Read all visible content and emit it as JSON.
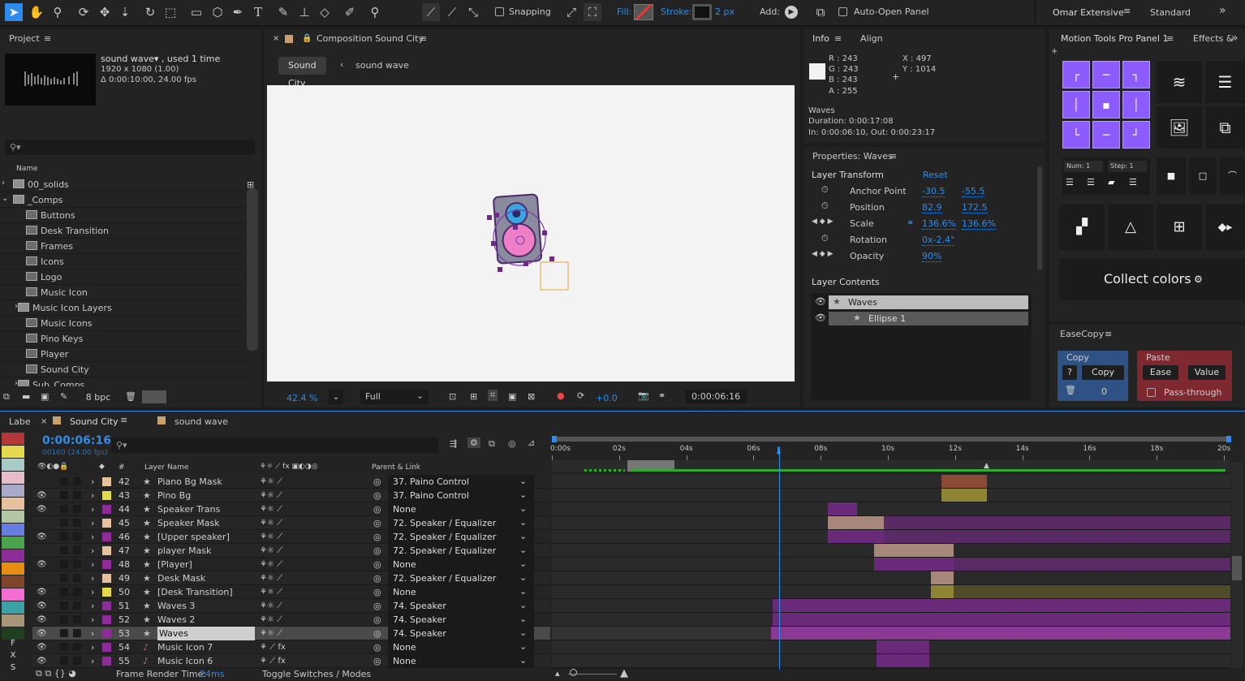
{
  "toolbar": {
    "snapping_label": "Snapping",
    "fill_label": "Fill:",
    "stroke_label": "Stroke:",
    "stroke_value": "2 px",
    "add_label": "Add:",
    "auto_open_label": "Auto-Open Panel",
    "workspace_active": "Omar Extensive",
    "workspace_other": "Standard"
  },
  "project": {
    "title": "Project",
    "item_name": "sound wave▾ , used 1 time",
    "item_res": "1920 x 1080 (1.00)",
    "item_dur": "Δ 0:00:10:00, 24.00 fps",
    "name_header": "Name",
    "bpc": "8 bpc",
    "items": [
      {
        "label": "00_solids",
        "type": "folder",
        "indent": 0
      },
      {
        "label": "_Comps",
        "type": "folder-open",
        "indent": 0
      },
      {
        "label": "Buttons",
        "type": "comp",
        "indent": 1
      },
      {
        "label": "Desk Transition",
        "type": "comp",
        "indent": 1
      },
      {
        "label": "Frames",
        "type": "comp",
        "indent": 1
      },
      {
        "label": "Icons",
        "type": "comp",
        "indent": 1
      },
      {
        "label": "Logo",
        "type": "comp",
        "indent": 1
      },
      {
        "label": "Music Icon",
        "type": "comp",
        "indent": 1
      },
      {
        "label": "Music Icon Layers",
        "type": "folder",
        "indent": 1
      },
      {
        "label": "Music Icons",
        "type": "comp",
        "indent": 1
      },
      {
        "label": "Pino Keys",
        "type": "comp",
        "indent": 1
      },
      {
        "label": "Player",
        "type": "comp",
        "indent": 1
      },
      {
        "label": "Sound City",
        "type": "comp",
        "indent": 1
      },
      {
        "label": "Sub_Comps",
        "type": "folder",
        "indent": 1
      }
    ]
  },
  "composition": {
    "title": "Composition Sound City",
    "crumb_active": "Sound City",
    "crumb_next": "sound wave",
    "zoom": "42.4 %",
    "quality": "Full",
    "exposure": "+0.0",
    "timecode": "0:00:06:16"
  },
  "info": {
    "tab_info": "Info",
    "tab_align": "Align",
    "r": "R : 243",
    "g": "G : 243",
    "b": "B : 243",
    "a": "A : 255",
    "x": "X : 497",
    "y": "Y : 1014",
    "layer": "Waves",
    "duration": "Duration: 0:00:17:08",
    "inout": "In: 0:00:06:10, Out: 0:00:23:17"
  },
  "properties": {
    "title": "Properties: Waves",
    "transform_label": "Layer Transform",
    "reset": "Reset",
    "props": [
      {
        "name": "Anchor Point",
        "v1": "-30.5",
        "v2": "-55.5"
      },
      {
        "name": "Position",
        "v1": "82.9",
        "v2": "172.5"
      },
      {
        "name": "Scale",
        "v1": "136.6%",
        "v2": "136.6%"
      },
      {
        "name": "Rotation",
        "v1": "0x-2.4°",
        "v2": ""
      },
      {
        "name": "Opacity",
        "v1": "90%",
        "v2": ""
      }
    ],
    "contents_label": "Layer Contents",
    "contents": [
      "Waves",
      "Ellipse 1"
    ]
  },
  "motion_tools": {
    "title": "Motion Tools Pro Panel 1",
    "effects_tab": "Effects &",
    "num_label": "Num: 1",
    "step_label": "Step: 1",
    "collect_colors": "Collect colors"
  },
  "easecopy": {
    "title": "EaseCopy",
    "copy_header": "Copy",
    "paste_header": "Paste",
    "help": "?",
    "copy_btn": "Copy",
    "ease_btn": "Ease",
    "value_btn": "Value",
    "count": "0",
    "passthrough": "Pass-through"
  },
  "timeline": {
    "label_col": "Labe",
    "tab_active": "Sound City",
    "tab_other": "sound wave",
    "timecode": "0:00:06:16",
    "frames": "00160 (24.00 fps)",
    "col_num": "#",
    "col_name": "Layer Name",
    "col_parent": "Parent & Link",
    "ruler": [
      "0:00s",
      "02s",
      "04s",
      "06s",
      "08s",
      "10s",
      "12s",
      "14s",
      "16s",
      "18s",
      "20s"
    ],
    "footer_render": "Frame Render Time:",
    "footer_render_value": "24ms",
    "footer_toggle": "Toggle Switches / Modes",
    "left_letters": [
      "F",
      "X",
      "S"
    ],
    "label_colors": [
      "#b53838",
      "#e4d84c",
      "#a9cbc7",
      "#e5bcc9",
      "#a9a9ca",
      "#e7c19e",
      "#b1c7a3",
      "#677de0",
      "#4aa44c",
      "#8e2c9a",
      "#e88d0f",
      "#7f452a",
      "#f46dd6",
      "#3da2a5",
      "#a89677",
      "#1e401e"
    ],
    "layers": [
      {
        "num": "42",
        "name": "Piano Bg Mask",
        "parent": "37. Paino Control",
        "color": "#e7c19e",
        "eye": false,
        "selected": false,
        "fx": false
      },
      {
        "num": "43",
        "name": "Pino Bg",
        "parent": "37. Paino Control",
        "color": "#e4d84c",
        "eye": true,
        "selected": false,
        "fx": false
      },
      {
        "num": "44",
        "name": "Speaker Trans",
        "parent": "None",
        "color": "#8e2c9a",
        "eye": true,
        "selected": false,
        "fx": false
      },
      {
        "num": "45",
        "name": "Speaker Mask",
        "parent": "72. Speaker / Equalizer",
        "color": "#e7c19e",
        "eye": false,
        "selected": false,
        "fx": false
      },
      {
        "num": "46",
        "name": "[Upper speaker]",
        "parent": "72. Speaker / Equalizer",
        "color": "#8e2c9a",
        "eye": true,
        "selected": false,
        "fx": false
      },
      {
        "num": "47",
        "name": "player Mask",
        "parent": "72. Speaker / Equalizer",
        "color": "#e7c19e",
        "eye": false,
        "selected": false,
        "fx": false
      },
      {
        "num": "48",
        "name": "[Player]",
        "parent": "None",
        "color": "#8e2c9a",
        "eye": true,
        "selected": false,
        "fx": false
      },
      {
        "num": "49",
        "name": "Desk Mask",
        "parent": "72. Speaker / Equalizer",
        "color": "#e7c19e",
        "eye": false,
        "selected": false,
        "fx": false
      },
      {
        "num": "50",
        "name": "[Desk Transition]",
        "parent": "None",
        "color": "#e4d84c",
        "eye": true,
        "selected": false,
        "fx": false
      },
      {
        "num": "51",
        "name": "Waves 3",
        "parent": "74. Speaker",
        "color": "#8e2c9a",
        "eye": true,
        "selected": false,
        "fx": false
      },
      {
        "num": "52",
        "name": "Waves 2",
        "parent": "74. Speaker",
        "color": "#8e2c9a",
        "eye": true,
        "selected": false,
        "fx": false
      },
      {
        "num": "53",
        "name": "Waves",
        "parent": "74. Speaker",
        "color": "#8e2c9a",
        "eye": true,
        "selected": true,
        "fx": false
      },
      {
        "num": "54",
        "name": "Music Icon 7",
        "parent": "None",
        "color": "#8e2c9a",
        "eye": true,
        "selected": false,
        "fx": true
      },
      {
        "num": "55",
        "name": "Music Icon 6",
        "parent": "None",
        "color": "#8e2c9a",
        "eye": true,
        "selected": false,
        "fx": true
      }
    ]
  }
}
